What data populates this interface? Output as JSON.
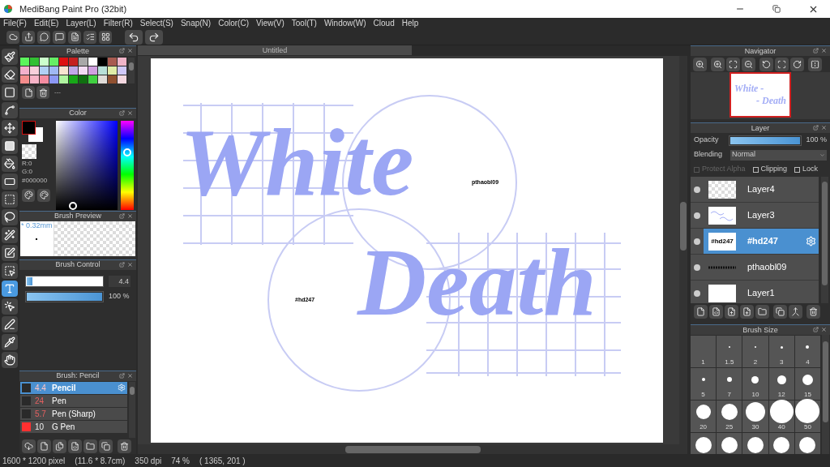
{
  "window": {
    "title": "MediBang Paint Pro (32bit)"
  },
  "menu": [
    "File(F)",
    "Edit(E)",
    "Layer(L)",
    "Filter(R)",
    "Select(S)",
    "Snap(N)",
    "Color(C)",
    "View(V)",
    "Tool(T)",
    "Window(W)",
    "Cloud",
    "Help"
  ],
  "tools": [
    {
      "selected": false
    },
    {
      "selected": false
    },
    {
      "selected": false
    },
    {
      "selected": false
    },
    {
      "selected": false
    },
    {
      "selected": false
    },
    {
      "selected": false
    },
    {
      "selected": false
    },
    {
      "selected": false
    },
    {
      "selected": false
    },
    {
      "selected": false
    },
    {
      "selected": false
    },
    {
      "selected": false
    },
    {
      "selected": true
    },
    {
      "selected": false
    },
    {
      "selected": false
    },
    {
      "selected": false
    },
    {
      "selected": false
    }
  ],
  "palette": {
    "title": "Palette",
    "note": "---",
    "swatches": [
      {
        "color": "#5cf55c"
      },
      {
        "color": "#33c033"
      },
      {
        "color": "#ccffcc"
      },
      {
        "color": "#66ee66"
      },
      {
        "color": "#dd1111"
      },
      {
        "color": "#c42020"
      },
      {
        "color": "#a8a8a8"
      },
      {
        "color": "#ffffff"
      },
      {
        "color": "#000000"
      },
      {
        "color": "#a85a50"
      },
      {
        "color": "#f0b4c8"
      },
      {
        "color": "#f4b0cc"
      },
      {
        "color": "#f8d0dc"
      },
      {
        "color": "#b0d0f4"
      },
      {
        "color": "#a0b8f4"
      },
      {
        "color": "#f8e4d0"
      },
      {
        "color": "#c0a8e8"
      },
      {
        "color": "#f4dcf4"
      },
      {
        "color": "#d0a0e0"
      },
      {
        "color": "#b8e0d8"
      },
      {
        "color": "#e0eca8"
      },
      {
        "color": "#d0c8f8"
      },
      {
        "color": "#f48c8c"
      },
      {
        "color": "#f8b4c8"
      },
      {
        "color": "#f48ca0"
      },
      {
        "color": "#8c98f4"
      },
      {
        "color": "#b0f4a0"
      },
      {
        "color": "#18a818"
      },
      {
        "color": "#107010"
      },
      {
        "color": "#40d040"
      },
      {
        "color": "#e0dcd8"
      },
      {
        "color": "#905030"
      },
      {
        "color": "#f4d8e0"
      }
    ]
  },
  "color": {
    "title": "Color",
    "readouts": [
      "R:0",
      "G:0"
    ],
    "hex": "#000000"
  },
  "brush_preview": {
    "title": "Brush Preview",
    "size": "* 0.32mm"
  },
  "brush_control": {
    "title": "Brush Control",
    "sliders": [
      {
        "kind": "field",
        "level": 0.07,
        "reading": "4.4"
      },
      {
        "kind": "plain",
        "level": 1,
        "reading": "100 %"
      }
    ]
  },
  "brush_list": {
    "title": "Brush: Pencil",
    "items": [
      {
        "size": "4.4",
        "name": "Pencil",
        "color": "#2a2a2a",
        "selected": true
      },
      {
        "size": "24",
        "name": "Pen",
        "color": "#2a2a2a",
        "selected": false
      },
      {
        "size": "5.7",
        "name": "Pen (Sharp)",
        "color": "#2a2a2a",
        "selected": false
      },
      {
        "size": "10",
        "name": "G Pen",
        "color": "#ff3030",
        "selected": false
      }
    ]
  },
  "document": {
    "tab": "Untitled",
    "items": [
      {
        "kind": "lettering",
        "text": "White"
      },
      {
        "kind": "label",
        "text": "pthaobl09"
      },
      {
        "kind": "lettering",
        "text": "Death"
      },
      {
        "kind": "label",
        "text": "#hd247"
      }
    ]
  },
  "navigator": {
    "title": "Navigator",
    "thumbnail_lines": [
      "White -",
      "- Death"
    ]
  },
  "layer_panel": {
    "title": "Layer",
    "opacity_label": "Opacity",
    "opacity": {
      "level": 1,
      "reading": "100 %"
    },
    "blending_label": "Blending",
    "blending": "Normal",
    "options": [
      {
        "label": "Protect Alpha",
        "checked": false,
        "disabled": true
      },
      {
        "label": "Clipping",
        "checked": false,
        "disabled": false
      },
      {
        "label": "Lock",
        "checked": false,
        "disabled": false
      }
    ],
    "layers": [
      {
        "name": "Layer4",
        "kind": "blank",
        "selected": false
      },
      {
        "name": "Layer3",
        "kind": "art",
        "selected": false
      },
      {
        "name": "#hd247",
        "kind": "text",
        "thumbnail_text": "#hd247",
        "selected": true
      },
      {
        "name": "pthaobl09",
        "kind": "scribble",
        "selected": false
      },
      {
        "name": "Layer1",
        "kind": "white",
        "selected": false
      }
    ]
  },
  "brush_size": {
    "title": "Brush Size",
    "sizes": [
      {
        "label": "1"
      },
      {
        "label": "1.5"
      },
      {
        "label": "2"
      },
      {
        "label": "3"
      },
      {
        "label": "4"
      },
      {
        "label": "5"
      },
      {
        "label": "7"
      },
      {
        "label": "10"
      },
      {
        "label": "12"
      },
      {
        "label": "15"
      },
      {
        "label": "20"
      },
      {
        "label": "25"
      },
      {
        "label": "30"
      },
      {
        "label": "40"
      },
      {
        "label": "50"
      }
    ]
  },
  "status_bar": [
    "1600 * 1200 pixel",
    "(11.6 * 8.7cm)",
    "350 dpi",
    "74 %",
    "( 1365, 201 )"
  ]
}
